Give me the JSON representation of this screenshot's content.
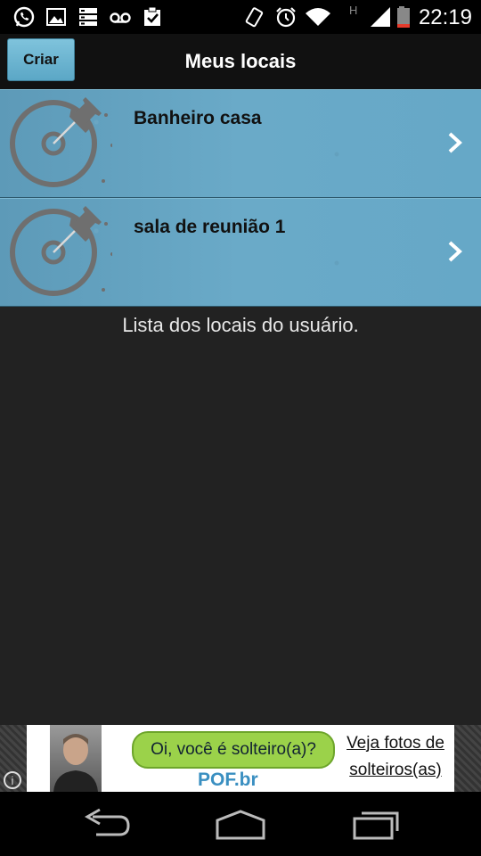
{
  "status_bar": {
    "time": "22:19",
    "network_type": "H",
    "icons": [
      "whatsapp-icon",
      "gallery-icon",
      "storage-icon",
      "voicemail-icon",
      "clipboard-check-icon",
      "vibrate-icon",
      "alarm-icon",
      "wifi-icon",
      "signal-icon",
      "battery-icon"
    ]
  },
  "header": {
    "create_label": "Criar",
    "title": "Meus locais"
  },
  "locations": [
    {
      "label": "Banheiro casa",
      "icon": "pushpin-target-icon"
    },
    {
      "label": "sala de reunião 1",
      "icon": "pushpin-target-icon"
    }
  ],
  "caption": "Lista dos locais do usuário.",
  "ad": {
    "bubble_text": "Oi, você é solteiro(a)?",
    "brand": "POF.br",
    "right_line1": "Veja fotos de",
    "right_line2": "solteiros(as)",
    "info_glyph": "i"
  },
  "nav": [
    "back-icon",
    "home-icon",
    "recents-icon"
  ],
  "colors": {
    "list_item_bg": "#66a8c7",
    "header_button": "#6ab3d2",
    "background": "#222222"
  }
}
